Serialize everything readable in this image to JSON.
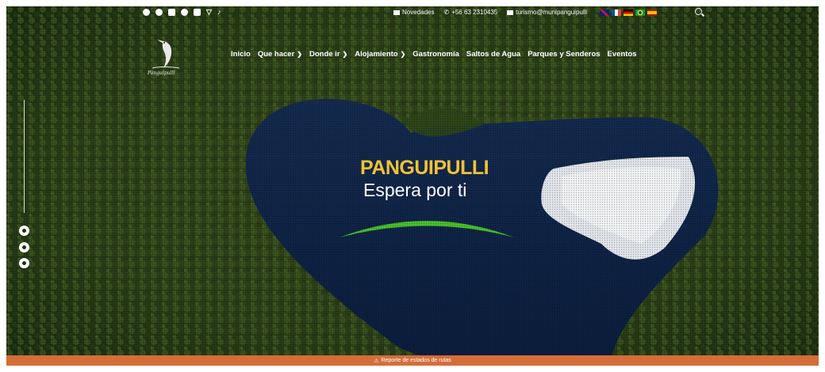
{
  "topbar": {
    "socials": [
      "whatsapp-icon",
      "spotify-icon",
      "instagram-icon",
      "facebook-icon",
      "youtube-icon",
      "twitter-icon",
      "tiktok-icon"
    ],
    "novedades": "Novedades",
    "phone": "+56 63 2310435",
    "email": "turismo@munipanguipulli",
    "flags": [
      "uk-flag",
      "france-flag",
      "germany-flag",
      "brazil-flag",
      "spain-flag"
    ]
  },
  "logo": {
    "text": "Panguipulli"
  },
  "nav": {
    "items": [
      {
        "label": "Inicio",
        "dropdown": false
      },
      {
        "label": "Que hacer",
        "dropdown": true
      },
      {
        "label": "Donde ir",
        "dropdown": true
      },
      {
        "label": "Alojamiento",
        "dropdown": true
      },
      {
        "label": "Gastronomía",
        "dropdown": false
      },
      {
        "label": "Saltos de Agua",
        "dropdown": false
      },
      {
        "label": "Parques y Senderos",
        "dropdown": false
      },
      {
        "label": "Eventos",
        "dropdown": false
      }
    ]
  },
  "side_socials": [
    "instagram-icon",
    "facebook-icon",
    "youtube-icon"
  ],
  "hero": {
    "title": "PANGUIPULLI",
    "subtitle": "Espera por ti"
  },
  "bottom_bar": {
    "label": "Reporte de estados de rutas"
  },
  "colors": {
    "accent_yellow": "#f2c232",
    "bar_orange": "#d46e39",
    "swoosh_green": "#49c22b"
  }
}
